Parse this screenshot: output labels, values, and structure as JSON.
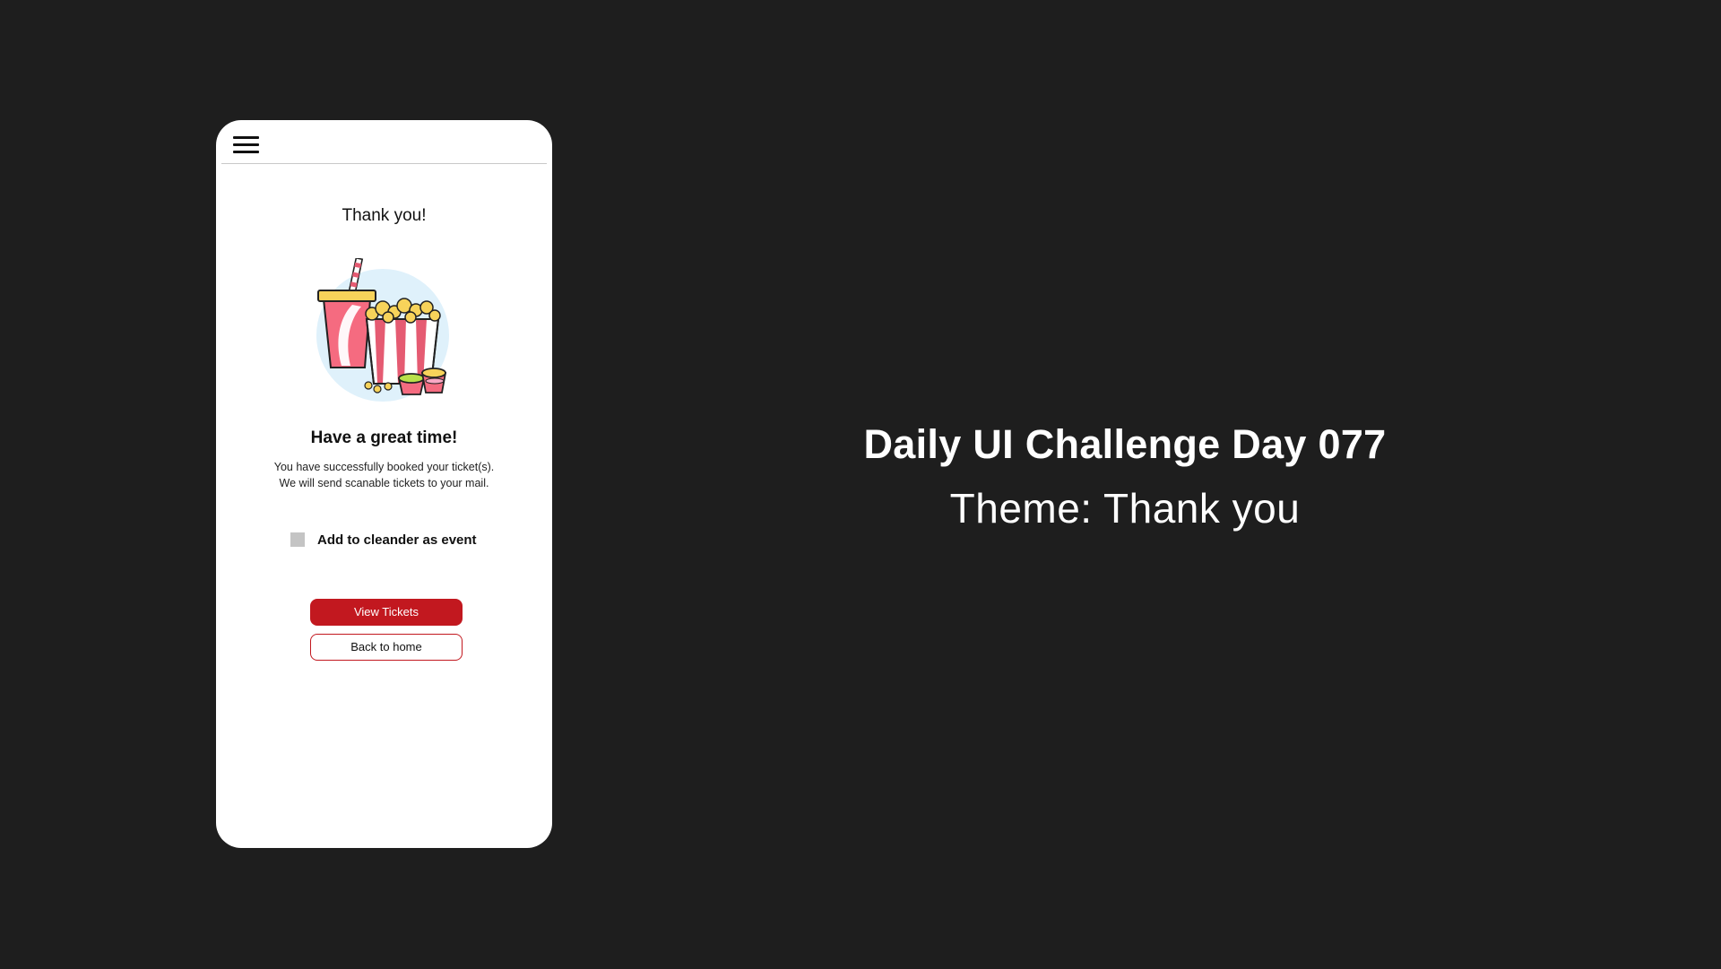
{
  "phone": {
    "title": "Thank you!",
    "heading": "Have a great time!",
    "message_line1": "You have successfully booked your ticket(s).",
    "message_line2": "We will send scanable tickets to your mail.",
    "calendar_label": "Add to cleander as event",
    "calendar_checked": false,
    "view_tickets_label": "View Tickets",
    "back_home_label": "Back to home",
    "illustration": "popcorn-and-soda-icon"
  },
  "caption": {
    "title": "Daily UI Challenge Day 077",
    "theme": "Theme: Thank you"
  },
  "colors": {
    "background": "#1e1e1e",
    "accent": "#c2181f",
    "checkbox": "#c4c4c4"
  }
}
